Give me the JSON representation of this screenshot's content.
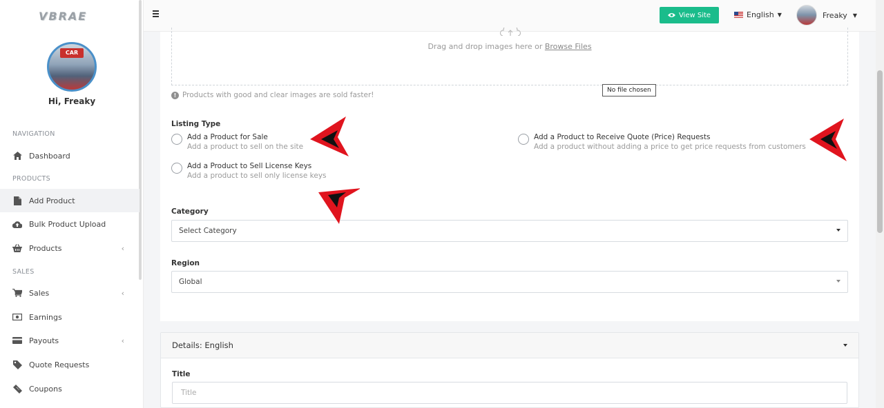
{
  "brand": {
    "logo_text": "VBRAE"
  },
  "sidebar": {
    "avatar_badge": "CAR",
    "greeting": "Hi, Freaky",
    "sections": {
      "navigation": "NAVIGATION",
      "products": "PRODUCTS",
      "sales": "SALES"
    },
    "items": [
      {
        "label": "Dashboard",
        "icon": "home-icon"
      },
      {
        "label": "Add Product",
        "icon": "file-icon",
        "active": true
      },
      {
        "label": "Bulk Product Upload",
        "icon": "cloud-upload-icon"
      },
      {
        "label": "Products",
        "icon": "basket-icon",
        "has_submenu": true
      },
      {
        "label": "Sales",
        "icon": "cart-icon",
        "has_submenu": true
      },
      {
        "label": "Earnings",
        "icon": "money-icon"
      },
      {
        "label": "Payouts",
        "icon": "credit-card-icon",
        "has_submenu": true
      },
      {
        "label": "Quote Requests",
        "icon": "tag-icon"
      },
      {
        "label": "Coupons",
        "icon": "ticket-icon"
      }
    ]
  },
  "topbar": {
    "view_site": "View Site",
    "language": "English",
    "username": "Freaky"
  },
  "upload": {
    "text": "Drag and drop images here or",
    "browse_link": "Browse Files",
    "file_status": "No file chosen",
    "hint": "Products with good and clear images are sold faster!"
  },
  "listing_type": {
    "label": "Listing Type",
    "options": [
      {
        "title": "Add a Product for Sale",
        "desc": "Add a product to sell on the site"
      },
      {
        "title": "Add a Product to Receive Quote (Price) Requests",
        "desc": "Add a product without adding a price to get price requests from customers"
      },
      {
        "title": "Add a Product to Sell License Keys",
        "desc": "Add a product to sell only license keys"
      }
    ]
  },
  "category": {
    "label": "Category",
    "value": "Select Category"
  },
  "region": {
    "label": "Region",
    "value": "Global"
  },
  "details": {
    "header": "Details: English",
    "title_label": "Title",
    "title_placeholder": "Title"
  },
  "colors": {
    "accent_green": "#1abc8b",
    "arrow_red": "#e0141e",
    "avatar_border": "#4a90c9"
  }
}
